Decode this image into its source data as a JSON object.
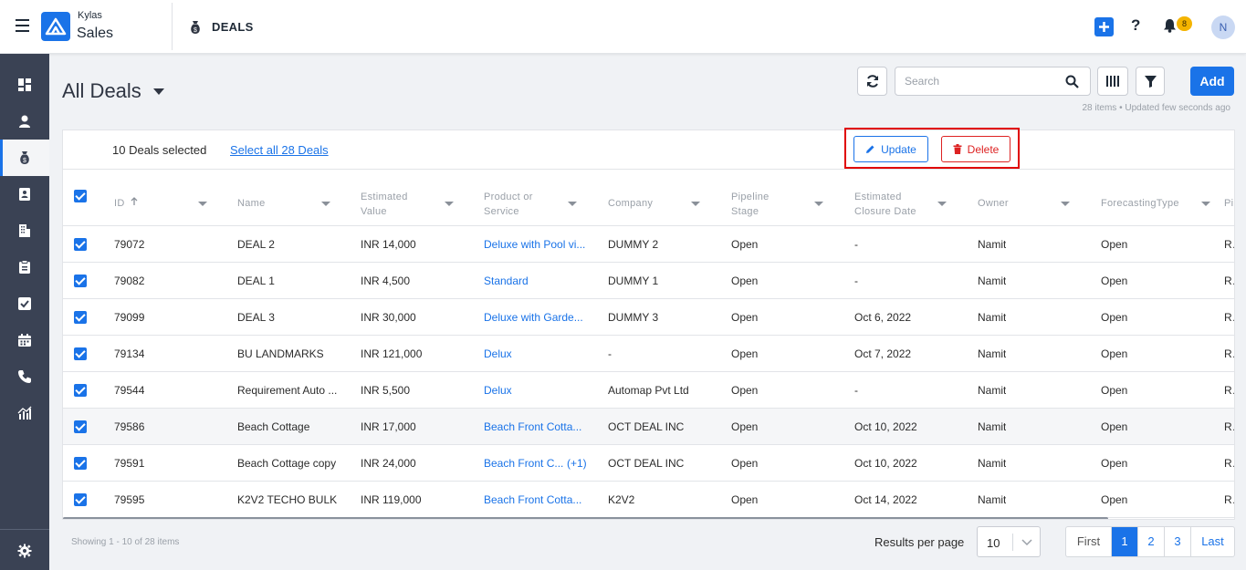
{
  "app": {
    "brand_top": "Kylas",
    "brand_bottom": "Sales",
    "section_title": "DEALS",
    "notification_count": "8",
    "avatar_initial": "N"
  },
  "icons": [
    "hamburger-icon",
    "money-bag-icon",
    "plus-icon",
    "help-icon",
    "bell-icon",
    "dashboard-icon",
    "user-icon",
    "deals-icon",
    "contact-card-icon",
    "building-icon",
    "clipboard-icon",
    "checkbox-icon",
    "calendar-icon",
    "phone-icon",
    "report-icon",
    "settings-icon",
    "refresh-icon",
    "search-icon",
    "columns-icon",
    "filter-icon",
    "pencil-icon",
    "trash-icon",
    "sort-up-icon"
  ],
  "header": {
    "title": "All Deals",
    "search_placeholder": "Search",
    "add_label": "Add",
    "items_meta": "28 items • Updated few seconds ago"
  },
  "selection": {
    "selected_text": "10 Deals selected",
    "select_all_label": "Select all 28 Deals",
    "update_label": "Update",
    "delete_label": "Delete"
  },
  "columns": [
    {
      "l1": "ID",
      "l2": ""
    },
    {
      "l1": "Name",
      "l2": ""
    },
    {
      "l1": "Estimated",
      "l2": "Value"
    },
    {
      "l1": "Product or",
      "l2": "Service"
    },
    {
      "l1": "Company",
      "l2": ""
    },
    {
      "l1": "Pipeline",
      "l2": "Stage"
    },
    {
      "l1": "Estimated",
      "l2": "Closure Date"
    },
    {
      "l1": "Owner",
      "l2": ""
    },
    {
      "l1": "ForecastingType",
      "l2": ""
    },
    {
      "l1": "Pi",
      "l2": ""
    }
  ],
  "rows": [
    {
      "id": "79072",
      "name": "DEAL 2",
      "value": "INR 14,000",
      "product": "Deluxe with Pool vi...",
      "extra": "",
      "company": "DUMMY 2",
      "stage": "Open",
      "closure": "-",
      "owner": "Namit",
      "forecast": "Open",
      "pi": "Ro"
    },
    {
      "id": "79082",
      "name": "DEAL 1",
      "value": "INR 4,500",
      "product": "Standard",
      "extra": "",
      "company": "DUMMY 1",
      "stage": "Open",
      "closure": "-",
      "owner": "Namit",
      "forecast": "Open",
      "pi": "Ro"
    },
    {
      "id": "79099",
      "name": "DEAL 3",
      "value": "INR 30,000",
      "product": "Deluxe with Garde...",
      "extra": "",
      "company": "DUMMY 3",
      "stage": "Open",
      "closure": "Oct 6, 2022",
      "owner": "Namit",
      "forecast": "Open",
      "pi": "Ro"
    },
    {
      "id": "79134",
      "name": "BU LANDMARKS",
      "value": "INR 121,000",
      "product": "Delux",
      "extra": "",
      "company": "-",
      "stage": "Open",
      "closure": "Oct 7, 2022",
      "owner": "Namit",
      "forecast": "Open",
      "pi": "Ro"
    },
    {
      "id": "79544",
      "name": "Requirement Auto ...",
      "value": "INR 5,500",
      "product": "Delux",
      "extra": "",
      "company": "Automap Pvt Ltd",
      "stage": "Open",
      "closure": "-",
      "owner": "Namit",
      "forecast": "Open",
      "pi": "Ro"
    },
    {
      "id": "79586",
      "name": "Beach Cottage",
      "value": "INR 17,000",
      "product": "Beach Front Cotta...",
      "extra": "",
      "company": "OCT DEAL INC",
      "stage": "Open",
      "closure": "Oct 10, 2022",
      "owner": "Namit",
      "forecast": "Open",
      "pi": "Ro"
    },
    {
      "id": "79591",
      "name": "Beach Cottage copy",
      "value": "INR 24,000",
      "product": "Beach Front C...",
      "extra": "(+1)",
      "company": "OCT DEAL INC",
      "stage": "Open",
      "closure": "Oct 10, 2022",
      "owner": "Namit",
      "forecast": "Open",
      "pi": "Ro"
    },
    {
      "id": "79595",
      "name": "K2V2 TECHO BULK",
      "value": "INR 119,000",
      "product": "Beach Front Cotta...",
      "extra": "",
      "company": "K2V2",
      "stage": "Open",
      "closure": "Oct 14, 2022",
      "owner": "Namit",
      "forecast": "Open",
      "pi": "Ro"
    }
  ],
  "footer": {
    "showing": "Showing 1 - 10 of 28 items",
    "rpp_label": "Results per page",
    "rpp_value": "10",
    "first": "First",
    "pages": [
      "1",
      "2",
      "3"
    ],
    "last": "Last"
  },
  "colors": {
    "accent": "#1a73e8",
    "sidebar": "#3a4254",
    "danger": "#dd2222",
    "highlight": "#e00000"
  }
}
